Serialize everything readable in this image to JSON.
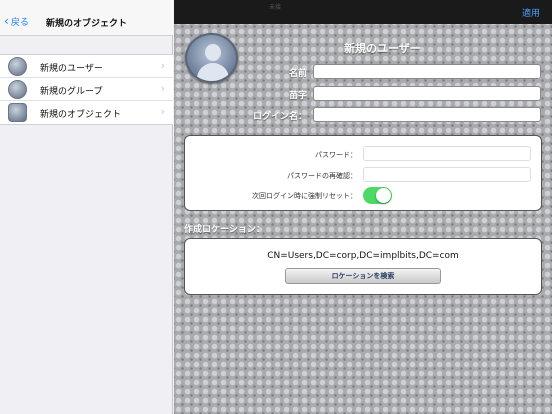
{
  "status_bar": {
    "device": "iPad",
    "wifi_icon": "wifi-icon"
  },
  "left_nav": {
    "back_label": "戻る",
    "title": "新規のオブジェクト"
  },
  "menu": [
    {
      "label": "新規のユーザー",
      "icon": "user-icon"
    },
    {
      "label": "新規のグループ",
      "icon": "group-icon"
    },
    {
      "label": "新規のオブジェクト",
      "icon": "object-icon"
    }
  ],
  "right_nav": {
    "top_faint": "未接",
    "apply_label": "適用"
  },
  "form": {
    "title": "新規のユーザー",
    "first_name_label": "名前",
    "last_name_label": "苗字",
    "login_label": "ログイン名：",
    "first_name_value": "",
    "last_name_value": "",
    "login_value": ""
  },
  "password": {
    "password_label": "パスワード：",
    "confirm_label": "パスワードの再確認：",
    "reset_label": "次回ログイン時に強制リセット：",
    "reset_enabled": true
  },
  "location": {
    "title": "作成ロケーション：",
    "value": "CN=Users,DC=corp,DC=implbits,DC=com",
    "search_button": "ロケーションを検索"
  },
  "colors": {
    "accent": "#1a7bff",
    "toggle_on": "#4cd964"
  }
}
